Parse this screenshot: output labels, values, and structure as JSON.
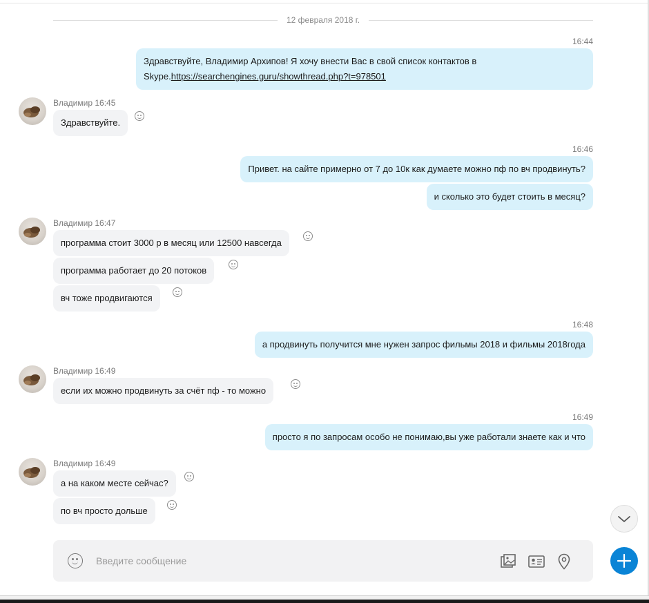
{
  "chat": {
    "date_separator": "12 февраля 2018 г.",
    "messages": [
      {
        "time": "16:44",
        "text_pre": "Здравствуйте, Владимир Архипов! Я хочу внести Вас в свой список контактов в Skype.",
        "link": "https://searchengines.guru/showthread.php?t=978501"
      },
      {
        "sender_meta": "Владимир 16:45",
        "text": "Здравствуйте."
      },
      {
        "time": "16:46",
        "text": "Привет. на сайте примерно от 7 до 10к как думаете можно пф по вч продвинуть?"
      },
      {
        "text": "и сколько это будет стоить в месяц?"
      },
      {
        "sender_meta": "Владимир 16:47",
        "text": "программа стоит 3000 р в месяц или 12500 навсегда"
      },
      {
        "text": "программа работает до 20 потоков"
      },
      {
        "text": "вч тоже продвигаются"
      },
      {
        "time": "16:48",
        "text": "а продвинуть получится мне нужен запрос фильмы 2018 и фильмы 2018года"
      },
      {
        "sender_meta": "Владимир 16:49",
        "text": "если их можно продвинуть за счёт пф - то можно"
      },
      {
        "time": "16:49",
        "text": "просто я по запросам особо не понимаю,вы уже работали знаете как и что"
      },
      {
        "sender_meta": "Владимир 16:49",
        "text": "а на каком месте сейчас?"
      },
      {
        "text": "по вч просто дольше"
      }
    ]
  },
  "composer": {
    "placeholder": "Введите сообщение",
    "icons": [
      "emoji-icon",
      "gallery-icon",
      "contact-card-icon",
      "location-pin-icon"
    ]
  },
  "fab": {
    "scroll_icon": "chevron-down-icon",
    "add_icon": "plus-icon"
  },
  "colors": {
    "outgoing_bubble": "#d8f1fb",
    "incoming_bubble": "#f2f3f5",
    "accent": "#0a84d6"
  }
}
